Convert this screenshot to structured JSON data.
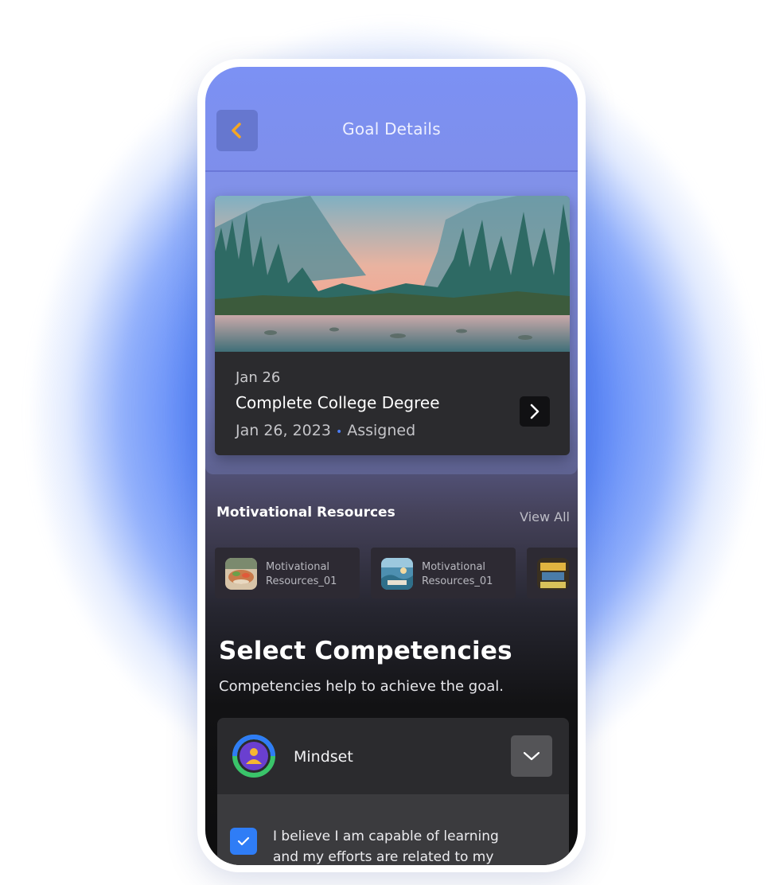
{
  "header": {
    "title": "Goal Details",
    "back_icon": "chevron-left-icon",
    "accent": "#f5a623"
  },
  "goal": {
    "short_date": "Jan 26",
    "name": "Complete College Degree",
    "full_date": "Jan 26, 2023",
    "separator": "•",
    "status": "Assigned",
    "open_icon": "chevron-right-icon"
  },
  "resources": {
    "title": "Motivational Resources",
    "view_all": "View All",
    "items": [
      {
        "label": "Motivational Resources_01",
        "thumb": "food-photo"
      },
      {
        "label": "Motivational Resources_01",
        "thumb": "beach-photo"
      },
      {
        "label": "",
        "thumb": "books-photo"
      }
    ]
  },
  "competencies": {
    "title": "Select Competencies",
    "subtitle": "Competencies help to achieve the goal.",
    "item": {
      "name": "Mindset",
      "icon": "mindset-icon",
      "expand_icon": "chevron-down-icon",
      "statement": "I believe I am capable of learning and my efforts are related to my",
      "checked": true
    }
  },
  "colors": {
    "check_blue": "#2f7df6",
    "status_dot": "#4a7cf5"
  }
}
